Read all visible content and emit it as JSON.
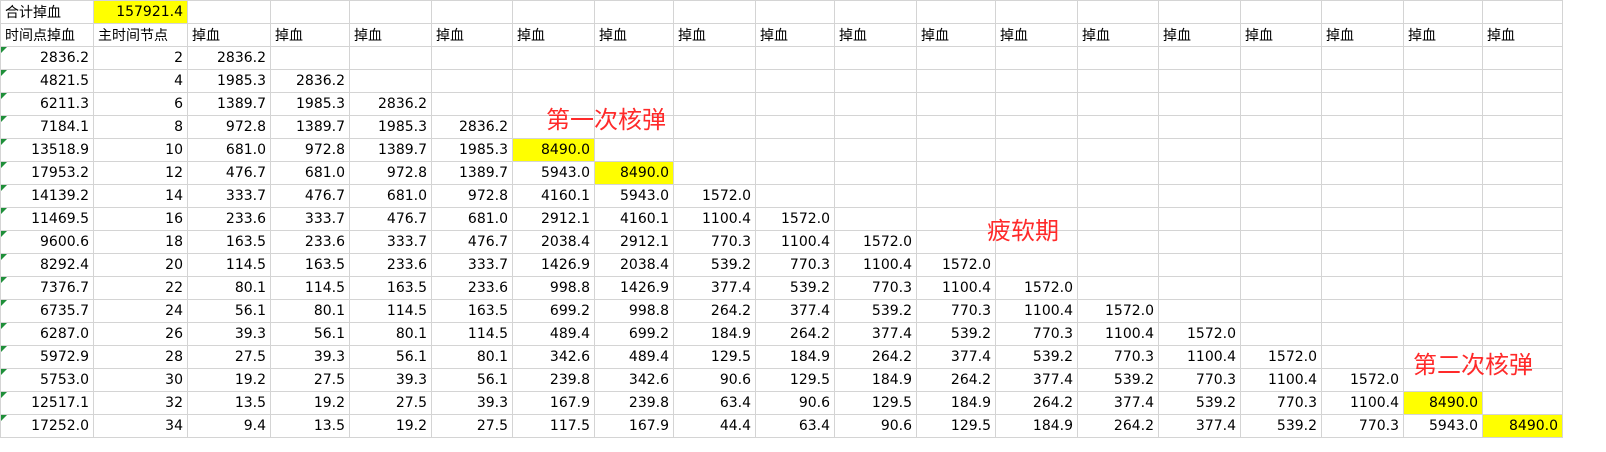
{
  "summary": {
    "label": "合计掉血",
    "value": "157921.4"
  },
  "headers": [
    "时间点掉血",
    "主时间节点",
    "掉血",
    "掉血",
    "掉血",
    "掉血",
    "掉血",
    "掉血",
    "掉血",
    "掉血",
    "掉血",
    "掉血",
    "掉血",
    "掉血",
    "掉血",
    "掉血",
    "掉血",
    "掉血",
    "掉血"
  ],
  "rows": [
    [
      "2836.2",
      "2",
      "2836.2"
    ],
    [
      "4821.5",
      "4",
      "1985.3",
      "2836.2"
    ],
    [
      "6211.3",
      "6",
      "1389.7",
      "1985.3",
      "2836.2"
    ],
    [
      "7184.1",
      "8",
      "972.8",
      "1389.7",
      "1985.3",
      "2836.2"
    ],
    [
      "13518.9",
      "10",
      "681.0",
      "972.8",
      "1389.7",
      "1985.3",
      "8490.0"
    ],
    [
      "17953.2",
      "12",
      "476.7",
      "681.0",
      "972.8",
      "1389.7",
      "5943.0",
      "8490.0"
    ],
    [
      "14139.2",
      "14",
      "333.7",
      "476.7",
      "681.0",
      "972.8",
      "4160.1",
      "5943.0",
      "1572.0"
    ],
    [
      "11469.5",
      "16",
      "233.6",
      "333.7",
      "476.7",
      "681.0",
      "2912.1",
      "4160.1",
      "1100.4",
      "1572.0"
    ],
    [
      "9600.6",
      "18",
      "163.5",
      "233.6",
      "333.7",
      "476.7",
      "2038.4",
      "2912.1",
      "770.3",
      "1100.4",
      "1572.0"
    ],
    [
      "8292.4",
      "20",
      "114.5",
      "163.5",
      "233.6",
      "333.7",
      "1426.9",
      "2038.4",
      "539.2",
      "770.3",
      "1100.4",
      "1572.0"
    ],
    [
      "7376.7",
      "22",
      "80.1",
      "114.5",
      "163.5",
      "233.6",
      "998.8",
      "1426.9",
      "377.4",
      "539.2",
      "770.3",
      "1100.4",
      "1572.0"
    ],
    [
      "6735.7",
      "24",
      "56.1",
      "80.1",
      "114.5",
      "163.5",
      "699.2",
      "998.8",
      "264.2",
      "377.4",
      "539.2",
      "770.3",
      "1100.4",
      "1572.0"
    ],
    [
      "6287.0",
      "26",
      "39.3",
      "56.1",
      "80.1",
      "114.5",
      "489.4",
      "699.2",
      "184.9",
      "264.2",
      "377.4",
      "539.2",
      "770.3",
      "1100.4",
      "1572.0"
    ],
    [
      "5972.9",
      "28",
      "27.5",
      "39.3",
      "56.1",
      "80.1",
      "342.6",
      "489.4",
      "129.5",
      "184.9",
      "264.2",
      "377.4",
      "539.2",
      "770.3",
      "1100.4",
      "1572.0"
    ],
    [
      "5753.0",
      "30",
      "19.2",
      "27.5",
      "39.3",
      "56.1",
      "239.8",
      "342.6",
      "90.6",
      "129.5",
      "184.9",
      "264.2",
      "377.4",
      "539.2",
      "770.3",
      "1100.4",
      "1572.0"
    ],
    [
      "12517.1",
      "32",
      "13.5",
      "19.2",
      "27.5",
      "39.3",
      "167.9",
      "239.8",
      "63.4",
      "90.6",
      "129.5",
      "184.9",
      "264.2",
      "377.4",
      "539.2",
      "770.3",
      "1100.4",
      "8490.0"
    ],
    [
      "17252.0",
      "34",
      "9.4",
      "13.5",
      "19.2",
      "27.5",
      "117.5",
      "167.9",
      "44.4",
      "63.4",
      "90.6",
      "129.5",
      "184.9",
      "264.2",
      "377.4",
      "539.2",
      "770.3",
      "5943.0",
      "8490.0"
    ]
  ],
  "highlights": [
    [
      4,
      6
    ],
    [
      5,
      7
    ],
    [
      15,
      17
    ],
    [
      16,
      18
    ]
  ],
  "annotations": {
    "first_nuke": "第一次核弹",
    "fatigue": "疲软期",
    "second_nuke": "第二次核弹"
  },
  "colors": {
    "highlight": "#ffff00",
    "annotation": "#ff2a2a",
    "grid": "#d4d4d4"
  }
}
